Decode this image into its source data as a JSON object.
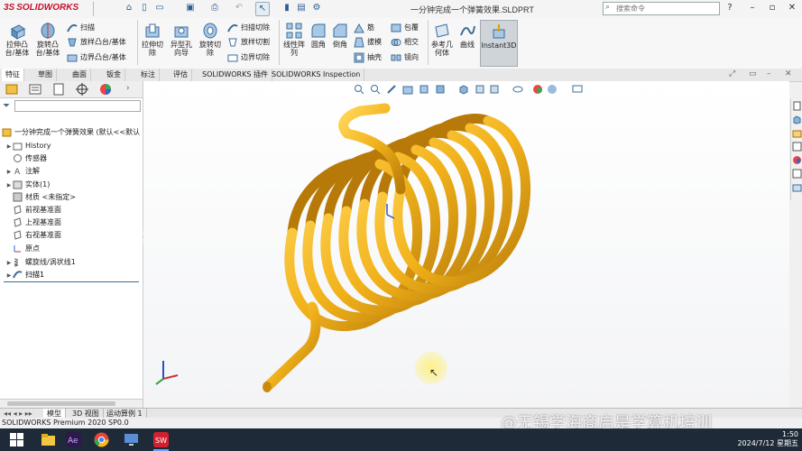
{
  "app": {
    "logo_text": "SOLIDWORKS",
    "logo_mark": "3S",
    "document_title": "一分钟完成一个弹簧效果.SLDPRT"
  },
  "search": {
    "placeholder": "搜索命令"
  },
  "ribbon": {
    "big_buttons": [
      "拉伸凸台/基体",
      "旋转凸台/基体",
      "拉伸切除",
      "异型孔向导",
      "旋转切除",
      "线性阵列",
      "圆角",
      "倒角",
      "参考几何体",
      "曲线",
      "Instant3D"
    ],
    "small_buttons": [
      "扫描",
      "放样凸台/基体",
      "边界凸台/基体",
      "扫描切除",
      "放样切割",
      "边界切除",
      "筋",
      "拔模",
      "抽壳",
      "包覆",
      "相交",
      "镜向"
    ]
  },
  "tabs": [
    "特征",
    "草图",
    "曲面",
    "钣金",
    "标注",
    "评估",
    "SOLIDWORKS 插件",
    "SOLIDWORKS Inspection"
  ],
  "active_tab": "特征",
  "feature_tree": {
    "root": "一分钟完成一个弹簧效果 (默认<<默认",
    "items": [
      "History",
      "传感器",
      "注解",
      "实体(1)",
      "材质 <未指定>",
      "前视基准面",
      "上视基准面",
      "右视基准面",
      "原点",
      "螺旋线/涡状线1",
      "扫描1"
    ]
  },
  "sheet_tabs": [
    "模型",
    "3D 视图",
    "运动算例 1"
  ],
  "status": {
    "text": "SOLIDWORKS Premium 2020 SP0.0"
  },
  "clock": {
    "time": "1:50",
    "date": "2024/7/12 星期五"
  },
  "watermark": "@无锡学海商启是学算机培训",
  "colors": {
    "spring": "#f2b21b",
    "spring_shadow": "#a87408",
    "logo": "#c8102e",
    "taskbar": "#1f2a38"
  }
}
